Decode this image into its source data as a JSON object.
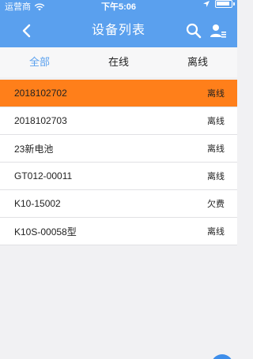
{
  "status_bar": {
    "carrier": "运营商",
    "time": "下午5:06",
    "wifi_icon": "wifi-icon",
    "location_icon": "location-arrow-icon",
    "battery_icon": "battery-icon"
  },
  "nav": {
    "title": "设备列表",
    "back_icon": "chevron-left-icon",
    "search_icon": "search-icon",
    "user_icon": "user-list-icon",
    "color": "#5aa0ee"
  },
  "tabs": [
    {
      "label": "全部",
      "active": true
    },
    {
      "label": "在线",
      "active": false
    },
    {
      "label": "离线",
      "active": false
    }
  ],
  "devices": [
    {
      "name": "2018102702",
      "status": "离线",
      "selected": true
    },
    {
      "name": "2018102703",
      "status": "离线",
      "selected": false
    },
    {
      "name": "23新电池",
      "status": "离线",
      "selected": false
    },
    {
      "name": "GT012-00011",
      "status": "离线",
      "selected": false
    },
    {
      "name": "K10-15002",
      "status": "欠费",
      "selected": false
    },
    {
      "name": "K10S-00058型",
      "status": "离线",
      "selected": false
    }
  ],
  "colors": {
    "accent": "#5aa0ee",
    "selected_row": "#ff7f1a",
    "background": "#f1f1f3"
  }
}
